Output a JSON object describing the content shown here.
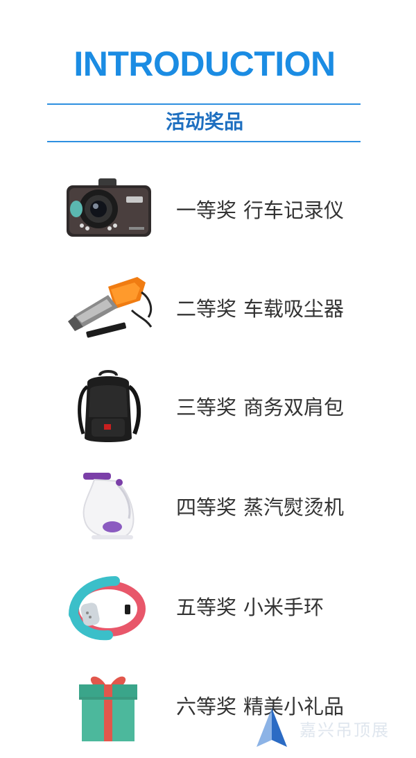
{
  "header": {
    "title": "INTRODUCTION",
    "subtitle": "活动奖品"
  },
  "prizes": [
    {
      "rank": "一等奖",
      "name": "行车记录仪",
      "icon": "dashcam-image"
    },
    {
      "rank": "二等奖",
      "name": "车载吸尘器",
      "icon": "car-vacuum-image"
    },
    {
      "rank": "三等奖",
      "name": "商务双肩包",
      "icon": "backpack-image"
    },
    {
      "rank": "四等奖",
      "name": "蒸汽熨烫机",
      "icon": "garment-steamer-image"
    },
    {
      "rank": "五等奖",
      "name": "小米手环",
      "icon": "fitness-band-image"
    },
    {
      "rank": "六等奖",
      "name": "精美小礼品",
      "icon": "gift-box-image"
    }
  ],
  "watermark": {
    "text": "嘉兴吊顶展"
  },
  "colors": {
    "accent": "#1b8ce3",
    "subtitle": "#1e6fc0",
    "text": "#333333"
  }
}
